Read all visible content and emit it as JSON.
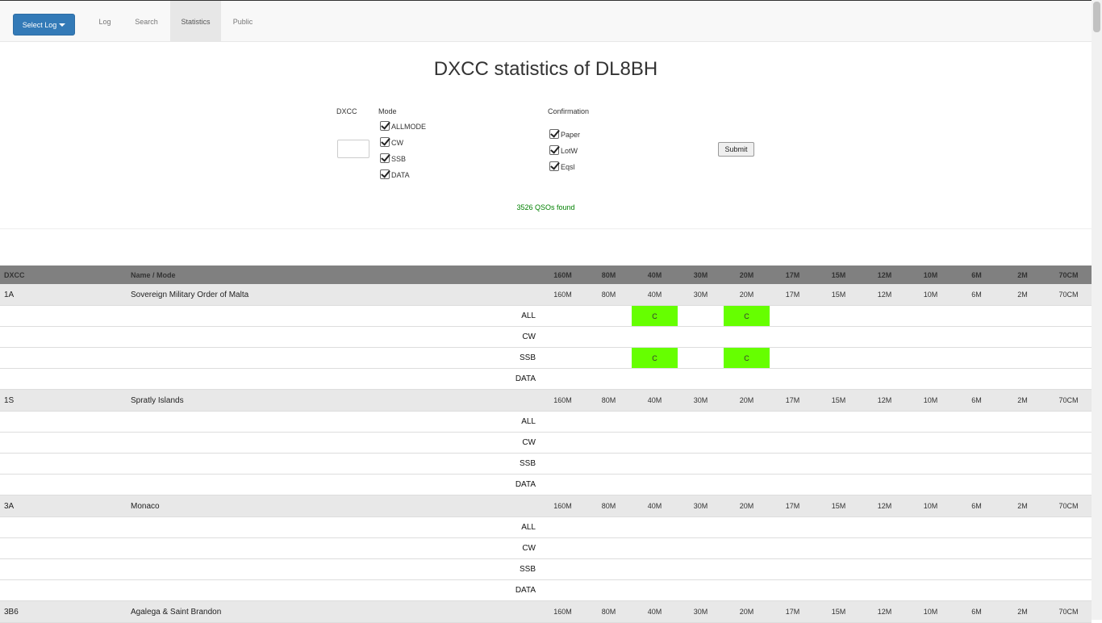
{
  "navbar": {
    "select_log_label": "Select Log",
    "items": [
      {
        "label": "Log"
      },
      {
        "label": "Search"
      },
      {
        "label": "Statistics",
        "active": true
      },
      {
        "label": "Public"
      }
    ]
  },
  "title": "DXCC statistics of DL8BH",
  "form": {
    "dxcc_label": "DXCC",
    "dxcc_value": "",
    "mode_label": "Mode",
    "modes": [
      {
        "label": "ALLMODE",
        "checked": true
      },
      {
        "label": "CW",
        "checked": true
      },
      {
        "label": "SSB",
        "checked": true
      },
      {
        "label": "DATA",
        "checked": true
      }
    ],
    "confirmation_label": "Confirmation",
    "confirmations": [
      {
        "label": "Paper",
        "checked": true
      },
      {
        "label": "LotW",
        "checked": true
      },
      {
        "label": "Eqsl",
        "checked": true
      }
    ],
    "submit_label": "Submit"
  },
  "status": "3526 QSOs found",
  "colors": {
    "confirmed": "#66ff00",
    "header_bg": "#808080",
    "group_bg": "#e8e8e8",
    "primary": "#337ab7"
  },
  "table": {
    "headers": {
      "dxcc": "DXCC",
      "name_mode": "Name / Mode"
    },
    "bands": [
      "160M",
      "80M",
      "40M",
      "30M",
      "20M",
      "17M",
      "15M",
      "12M",
      "10M",
      "6M",
      "2M",
      "70CM"
    ],
    "entities": [
      {
        "prefix": "1A",
        "name": "Sovereign Military Order of Malta",
        "modes": [
          {
            "mode": "ALL",
            "cells": [
              "",
              "",
              "C",
              "",
              "C",
              "",
              "",
              "",
              "",
              "",
              "",
              ""
            ]
          },
          {
            "mode": "CW",
            "cells": [
              "",
              "",
              "",
              "",
              "",
              "",
              "",
              "",
              "",
              "",
              "",
              ""
            ]
          },
          {
            "mode": "SSB",
            "cells": [
              "",
              "",
              "C",
              "",
              "C",
              "",
              "",
              "",
              "",
              "",
              "",
              ""
            ]
          },
          {
            "mode": "DATA",
            "cells": [
              "",
              "",
              "",
              "",
              "",
              "",
              "",
              "",
              "",
              "",
              "",
              ""
            ]
          }
        ]
      },
      {
        "prefix": "1S",
        "name": "Spratly Islands",
        "modes": [
          {
            "mode": "ALL",
            "cells": [
              "",
              "",
              "",
              "",
              "",
              "",
              "",
              "",
              "",
              "",
              "",
              ""
            ]
          },
          {
            "mode": "CW",
            "cells": [
              "",
              "",
              "",
              "",
              "",
              "",
              "",
              "",
              "",
              "",
              "",
              ""
            ]
          },
          {
            "mode": "SSB",
            "cells": [
              "",
              "",
              "",
              "",
              "",
              "",
              "",
              "",
              "",
              "",
              "",
              ""
            ]
          },
          {
            "mode": "DATA",
            "cells": [
              "",
              "",
              "",
              "",
              "",
              "",
              "",
              "",
              "",
              "",
              "",
              ""
            ]
          }
        ]
      },
      {
        "prefix": "3A",
        "name": "Monaco",
        "modes": [
          {
            "mode": "ALL",
            "cells": [
              "",
              "",
              "",
              "",
              "",
              "",
              "",
              "",
              "",
              "",
              "",
              ""
            ]
          },
          {
            "mode": "CW",
            "cells": [
              "",
              "",
              "",
              "",
              "",
              "",
              "",
              "",
              "",
              "",
              "",
              ""
            ]
          },
          {
            "mode": "SSB",
            "cells": [
              "",
              "",
              "",
              "",
              "",
              "",
              "",
              "",
              "",
              "",
              "",
              ""
            ]
          },
          {
            "mode": "DATA",
            "cells": [
              "",
              "",
              "",
              "",
              "",
              "",
              "",
              "",
              "",
              "",
              "",
              ""
            ]
          }
        ]
      },
      {
        "prefix": "3B6",
        "name": "Agalega & Saint Brandon",
        "modes": []
      }
    ]
  }
}
